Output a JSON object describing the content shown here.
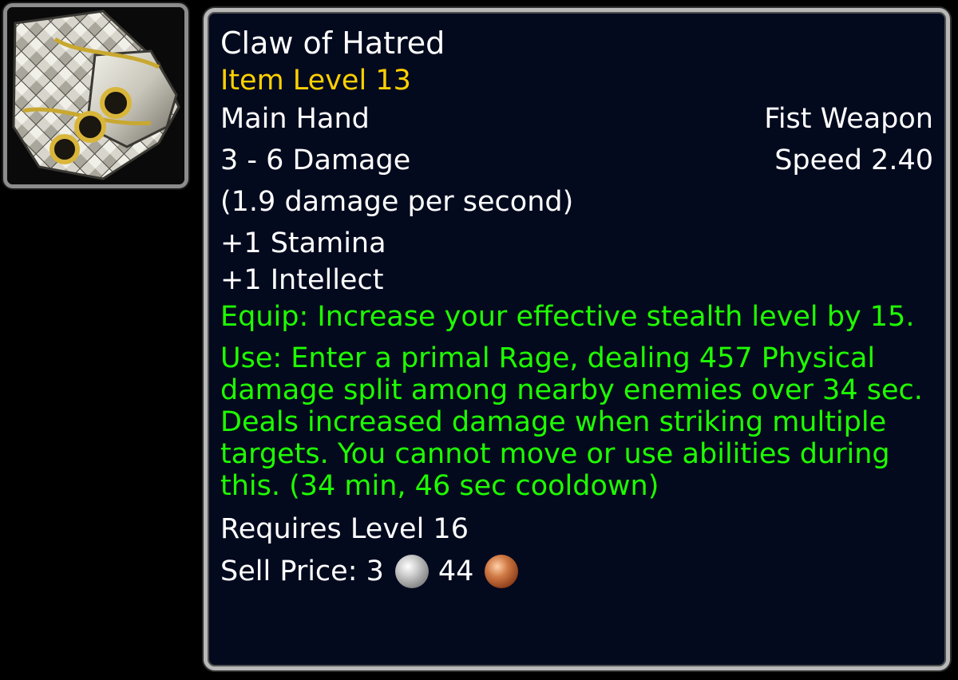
{
  "icon": {
    "name": "fist-weapon-icon"
  },
  "tooltip": {
    "title": "Claw of Hatred",
    "item_level": "Item Level 13",
    "slot": "Main Hand",
    "weapon_type": "Fist Weapon",
    "damage": "3 - 6 Damage",
    "speed": "Speed 2.40",
    "dps": "(1.9 damage per second)",
    "stats": [
      "+1 Stamina",
      "+1 Intellect"
    ],
    "equip": "Equip: Increase your effective stealth level by 15.",
    "use": "Use: Enter a primal Rage, dealing 457 Physical damage split among nearby enemies over 34 sec. Deals increased damage when striking multiple targets. You cannot move or use abilities during this. (34 min, 46 sec cooldown)",
    "requires": "Requires Level 16",
    "sell_label": "Sell Price: 3",
    "sell_copper": "44"
  },
  "colors": {
    "background": "#040a1e",
    "border": "#b8b8b8",
    "item_level": "#ffd100",
    "effect_text": "#1eff00",
    "text": "#ffffff"
  }
}
